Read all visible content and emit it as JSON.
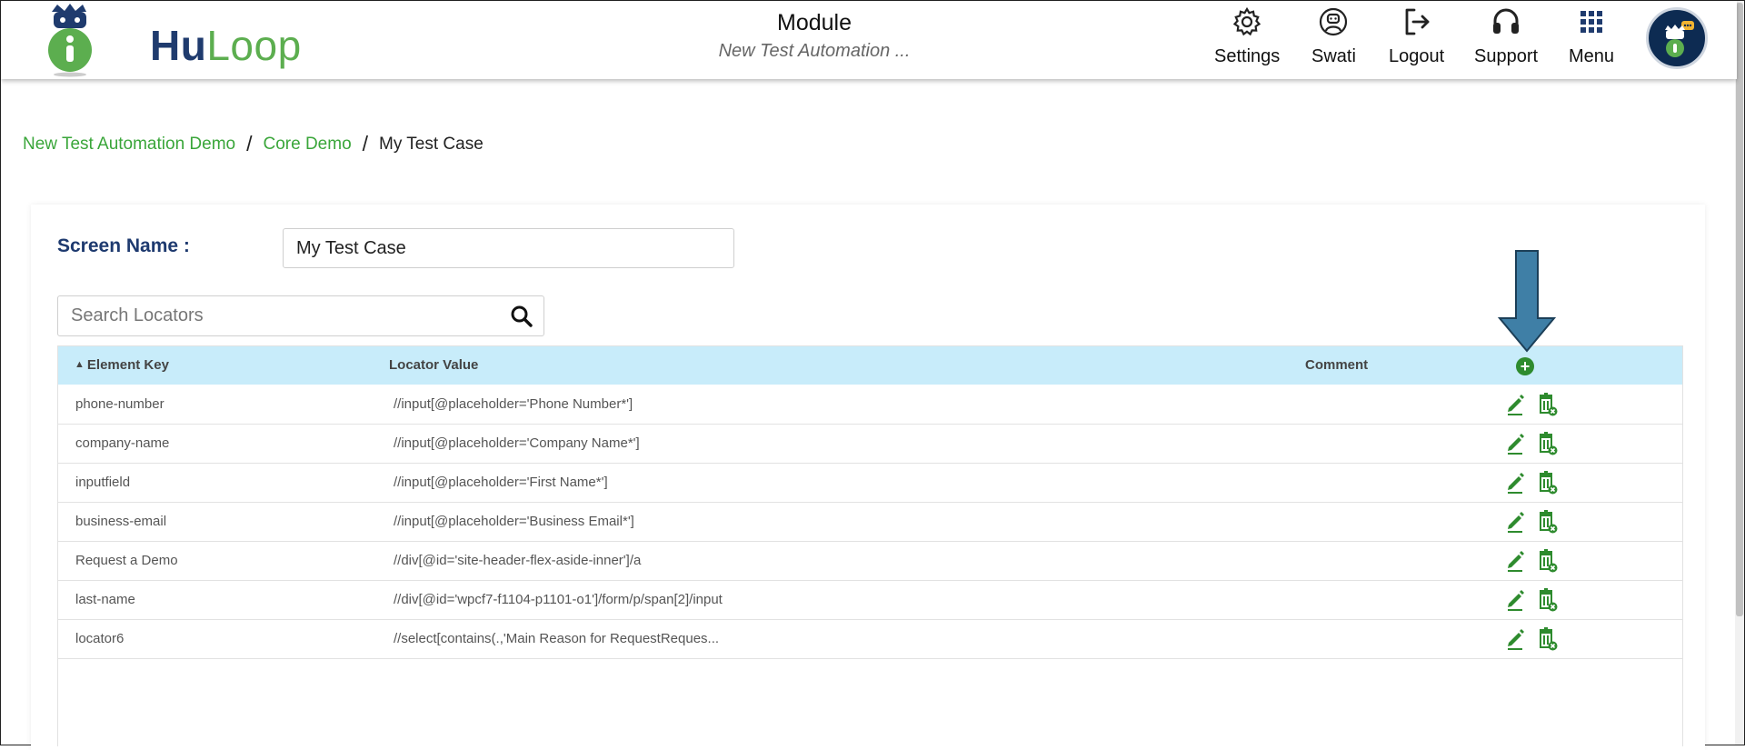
{
  "header": {
    "logo_text_hu": "Hu",
    "logo_text_loop": "Loop",
    "module_title": "Module",
    "module_subtitle": "New Test Automation ...",
    "nav": [
      {
        "label": "Settings",
        "icon": "gear-icon"
      },
      {
        "label": "Swati",
        "icon": "user-icon"
      },
      {
        "label": "Logout",
        "icon": "logout-icon"
      },
      {
        "label": "Support",
        "icon": "headphones-icon"
      },
      {
        "label": "Menu",
        "icon": "grid-icon"
      }
    ]
  },
  "breadcrumb": {
    "items": [
      "New Test Automation Demo",
      "Core Demo"
    ],
    "separator": "/",
    "current": "My Test Case"
  },
  "screen": {
    "label": "Screen Name :",
    "value": "My Test Case"
  },
  "search": {
    "placeholder": "Search Locators"
  },
  "table": {
    "columns": {
      "element_key": "Element Key",
      "locator_value": "Locator Value",
      "comment": "Comment"
    },
    "rows": [
      {
        "key": "phone-number",
        "value": "//input[@placeholder='Phone Number*']"
      },
      {
        "key": "company-name",
        "value": "//input[@placeholder='Company Name*']"
      },
      {
        "key": "inputfield",
        "value": "//input[@placeholder='First Name*']"
      },
      {
        "key": "business-email",
        "value": "//input[@placeholder='Business Email*']"
      },
      {
        "key": "Request a Demo",
        "value": "//div[@id='site-header-flex-aside-inner']/a"
      },
      {
        "key": "last-name",
        "value": "//div[@id='wpcf7-f1104-p1101-o1']/form/p/span[2]/input"
      },
      {
        "key": "locator6",
        "value": "//select[contains(.,'Main Reason for RequestReques..."
      }
    ]
  },
  "colors": {
    "accent_green": "#3aa63a",
    "header_navy": "#1e3a6f",
    "table_header_bg": "#c8ecfa",
    "arrow_blue": "#3f7fa6"
  }
}
